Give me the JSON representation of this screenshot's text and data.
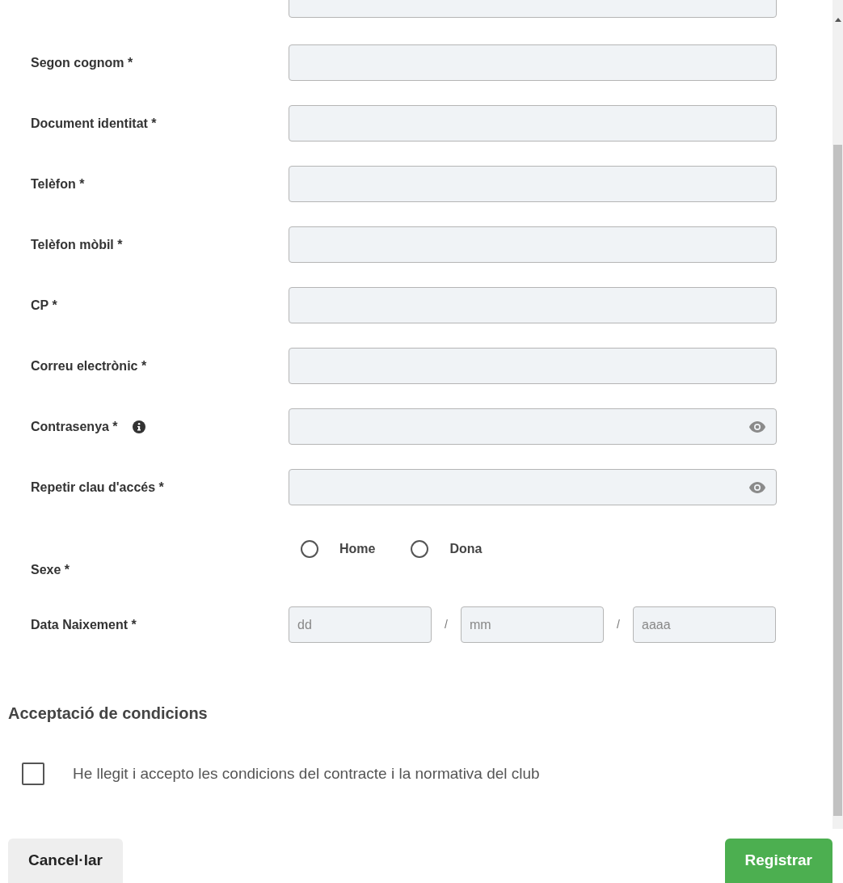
{
  "fields": [
    {
      "kind": "text",
      "label": "Segon cognom *",
      "info": false
    },
    {
      "kind": "text",
      "label": "Document identitat *",
      "info": false
    },
    {
      "kind": "text",
      "label": "Telèfon *",
      "info": false
    },
    {
      "kind": "text",
      "label": "Telèfon mòbil *",
      "info": false
    },
    {
      "kind": "text",
      "label": "CP *",
      "info": false
    },
    {
      "kind": "text",
      "label": "Correu electrònic *",
      "info": false
    },
    {
      "kind": "password",
      "label": "Contrasenya *",
      "info": true
    },
    {
      "kind": "password",
      "label": "Repetir clau d'accés *",
      "info": false
    }
  ],
  "sex": {
    "label": "Sexe *",
    "options": [
      {
        "label": "Home",
        "selected": false
      },
      {
        "label": "Dona",
        "selected": false
      }
    ]
  },
  "birth_date": {
    "label": "Data Naixement *",
    "parts": [
      {
        "placeholder": "dd"
      },
      {
        "placeholder": "mm"
      },
      {
        "placeholder": "aaaa"
      }
    ],
    "separators": [
      "/",
      "/"
    ]
  },
  "conditions": {
    "heading": "Acceptació de condicions",
    "text": "He llegit i accepto les condicions del contracte i la normativa del club",
    "checked": false
  },
  "buttons": [
    {
      "kind": "secondary",
      "label": "Cancel·lar"
    },
    {
      "kind": "primary",
      "label": "Registrar"
    }
  ]
}
